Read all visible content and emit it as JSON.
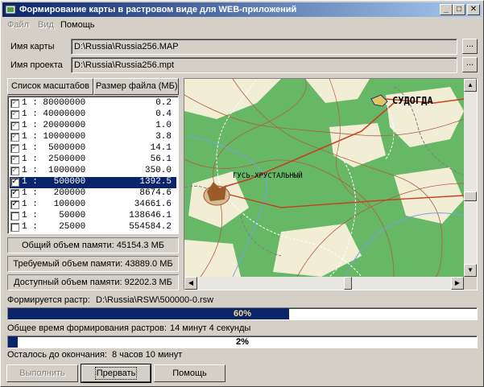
{
  "window": {
    "title": "Формирование карты в растровом виде для WEB-приложений",
    "controls": {
      "minimize": "_",
      "maximize": "□",
      "close": "✕"
    }
  },
  "menu": [
    {
      "label": "Файл",
      "enabled": false
    },
    {
      "label": "Вид",
      "enabled": false
    },
    {
      "label": "Помощь",
      "enabled": true
    }
  ],
  "map_name": {
    "label": "Имя карты",
    "value": "D:\\Russia\\Russia256.MAP",
    "browse": "..."
  },
  "project_name": {
    "label": "Имя проекта",
    "value": "D:\\Russia\\Russia256.mpt",
    "browse": "..."
  },
  "scales_table": {
    "headers": [
      "Список масштабов",
      "Размер файла (МБ)"
    ],
    "rows": [
      {
        "scale": "1 : 80000000",
        "size": "0.2",
        "checked": true,
        "selected": false
      },
      {
        "scale": "1 : 40000000",
        "size": "0.4",
        "checked": true,
        "selected": false
      },
      {
        "scale": "1 : 20000000",
        "size": "1.0",
        "checked": true,
        "selected": false
      },
      {
        "scale": "1 : 10000000",
        "size": "3.8",
        "checked": true,
        "selected": false
      },
      {
        "scale": "1 :  5000000",
        "size": "14.1",
        "checked": true,
        "selected": false
      },
      {
        "scale": "1 :  2500000",
        "size": "56.1",
        "checked": true,
        "selected": false
      },
      {
        "scale": "1 :  1000000",
        "size": "350.0",
        "checked": true,
        "selected": false
      },
      {
        "scale": "1 :   500000",
        "size": "1392.5",
        "checked": true,
        "selected": true
      },
      {
        "scale": "1 :   200000",
        "size": "8674.6",
        "checked": true,
        "selected": false
      },
      {
        "scale": "1 :   100000",
        "size": "34661.6",
        "checked": true,
        "selected": false
      },
      {
        "scale": "1 :    50000",
        "size": "138646.1",
        "checked": false,
        "selected": false
      },
      {
        "scale": "1 :    25000",
        "size": "554584.2",
        "checked": false,
        "selected": false
      }
    ]
  },
  "stats": {
    "total": "Общий объем памяти: 45154.3 МБ",
    "required": "Требуемый объем памяти: 43889.0 МБ",
    "available": "Доступный объем памяти: 92202.3 МБ"
  },
  "map": {
    "labels": {
      "city1": "СУДОГДА",
      "city2": "ГУСЬ-ХРУСТАЛЬНЫЙ"
    },
    "colors": {
      "forest": "#66b866",
      "field": "#f0ecd0",
      "road": "#c0502a",
      "river": "#7aa0e0"
    }
  },
  "progress": {
    "raster_label": "Формируется растр:",
    "raster_path": "D:\\Russia\\RSW\\500000-0.rsw",
    "bar1_text": "60%",
    "bar1_fraction": 0.6,
    "total_time_label": "Общее время формирования растров:",
    "total_time_value": "14 минут 4 секунды",
    "bar2_text": "2%",
    "bar2_fraction": 0.02,
    "remaining_label": "Осталось до окончания:",
    "remaining_value": "8 часов 10 минут"
  },
  "buttons": {
    "run": "Выполнить",
    "abort": "Прервать",
    "help": "Помощь"
  }
}
